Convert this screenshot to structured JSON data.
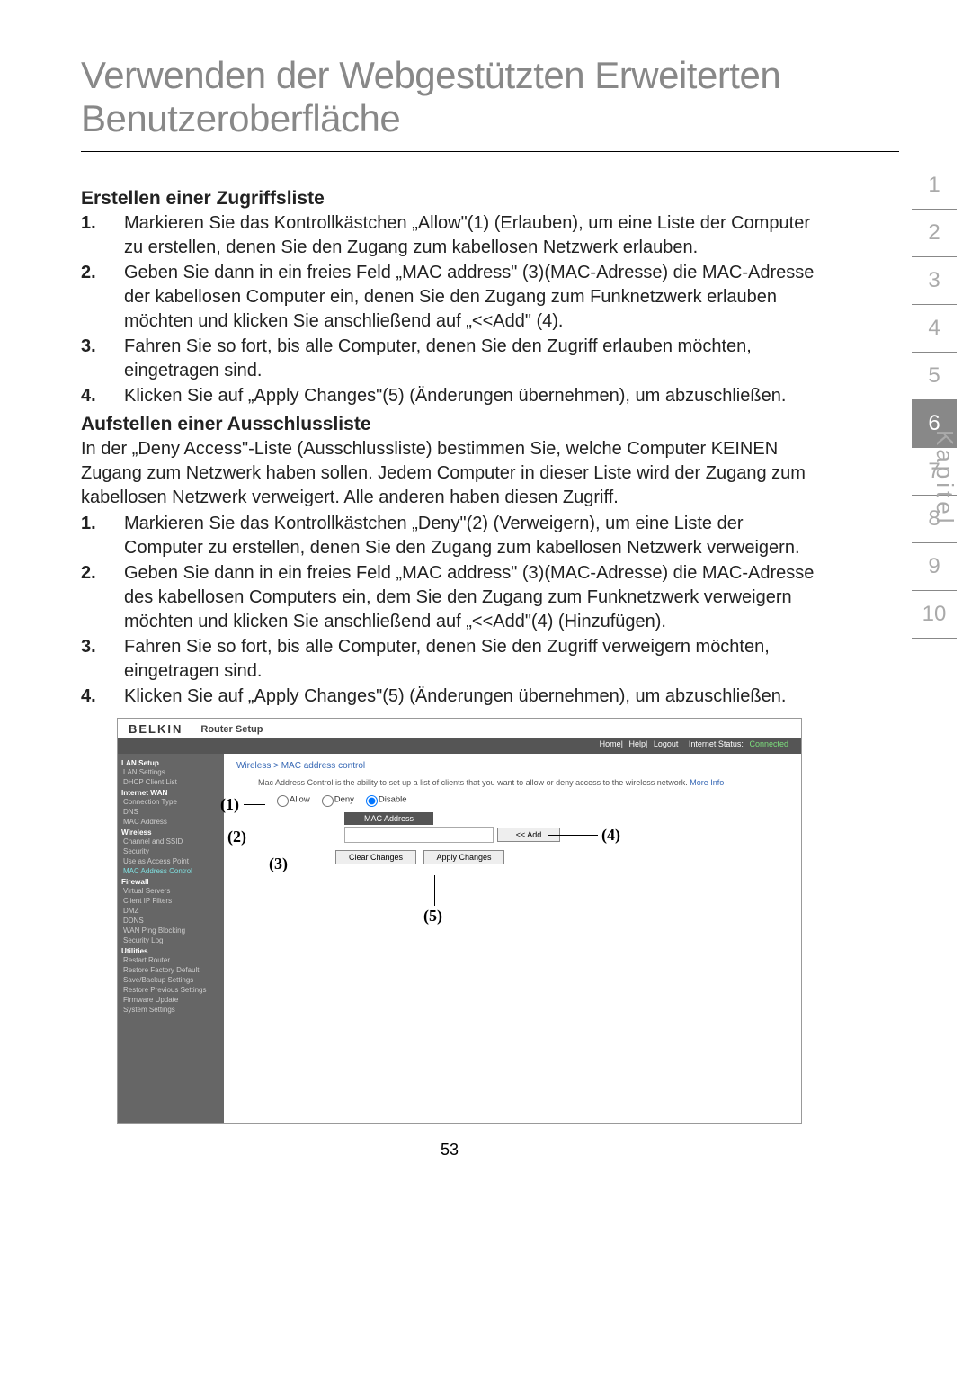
{
  "page": {
    "title": "Verwenden der Webgestützten Erweiterten Benutzeroberfläche",
    "number": "53"
  },
  "section1": {
    "heading": "Erstellen einer Zugriffsliste",
    "items": [
      {
        "n": "1.",
        "text": "Markieren Sie das Kontrollkästchen „Allow\"(1) (Erlauben), um eine Liste der Computer zu erstellen, denen Sie den Zugang zum kabellosen Netzwerk erlauben."
      },
      {
        "n": "2.",
        "text": "Geben Sie dann in ein freies Feld „MAC address\" (3)(MAC-Adresse) die MAC-Adresse der kabellosen Computer ein, denen Sie den Zugang zum Funknetzwerk erlauben möchten und klicken Sie anschließend auf „<<Add\" (4)."
      },
      {
        "n": "3.",
        "text": "Fahren Sie so fort, bis alle Computer, denen Sie den Zugriff erlauben möchten, eingetragen sind."
      },
      {
        "n": "4.",
        "text": "Klicken Sie auf „Apply Changes\"(5) (Änderungen übernehmen), um abzuschließen."
      }
    ]
  },
  "section2": {
    "heading": "Aufstellen einer Ausschlussliste",
    "intro": " In der „Deny Access\"-Liste (Ausschlussliste) bestimmen Sie, welche Computer KEINEN Zugang zum Netzwerk haben sollen. Jedem Computer in dieser Liste wird der Zugang zum kabellosen Netzwerk verweigert. Alle anderen haben diesen Zugriff.",
    "items": [
      {
        "n": "1.",
        "text": "Markieren Sie das Kontrollkästchen „Deny\"(2) (Verweigern), um eine Liste der Computer zu erstellen, denen Sie den Zugang zum kabellosen Netzwerk verweigern."
      },
      {
        "n": "2.",
        "text": "Geben Sie dann in ein freies Feld „MAC address\" (3)(MAC-Adresse) die MAC-Adresse des kabellosen Computers ein, dem Sie den Zugang zum Funknetzwerk verweigern möchten und klicken Sie anschließend auf „<<Add\"(4) (Hinzufügen)."
      },
      {
        "n": "3.",
        "text": "Fahren Sie so fort, bis alle Computer, denen Sie den Zugriff verweigern möchten, eingetragen sind."
      },
      {
        "n": "4.",
        "text": "Klicken Sie auf „Apply Changes\"(5) (Änderungen übernehmen), um abzuschließen."
      }
    ]
  },
  "chapter_nav": {
    "label": "Kapitel",
    "items": [
      "1",
      "2",
      "3",
      "4",
      "5",
      "6",
      "7",
      "8",
      "9",
      "10"
    ],
    "active": "6"
  },
  "screenshot": {
    "logo": "BELKIN",
    "router_setup": "Router Setup",
    "topbar": {
      "home": "Home",
      "help": "Help",
      "logout": "Logout",
      "status_label": "Internet Status:",
      "status_value": "Connected"
    },
    "breadcrumb": "Wireless > MAC address control",
    "desc": "Mac Address Control is the ability to set up a list of clients that you want to allow or deny access to the wireless network.",
    "more_info": "More Info",
    "options": {
      "allow": "Allow",
      "deny": "Deny",
      "disable": "Disable"
    },
    "mac_header": "MAC Address",
    "add_btn": "<< Add",
    "clear_btn": "Clear Changes",
    "apply_btn": "Apply Changes",
    "annotations": {
      "a1": "(1)",
      "a2": "(2)",
      "a3": "(3)",
      "a4": "(4)",
      "a5": "(5)"
    },
    "sidebar": {
      "lan_setup": "LAN Setup",
      "lan_settings": "LAN Settings",
      "dhcp": "DHCP Client List",
      "internet_wan": "Internet WAN",
      "conn_type": "Connection Type",
      "dns": "DNS",
      "mac_addr": "MAC Address",
      "wireless": "Wireless",
      "channel_ssid": "Channel and SSID",
      "security": "Security",
      "use_ap": "Use as Access Point",
      "mac_ctrl": "MAC Address Control",
      "firewall": "Firewall",
      "virtual_servers": "Virtual Servers",
      "client_ip": "Client IP Filters",
      "dmz": "DMZ",
      "ddns": "DDNS",
      "wan_ping": "WAN Ping Blocking",
      "security_log": "Security Log",
      "utilities": "Utilities",
      "restart": "Restart Router",
      "restore_fd": "Restore Factory Default",
      "save_backup": "Save/Backup Settings",
      "restore_prev": "Restore Previous Settings",
      "firmware": "Firmware Update",
      "system": "System Settings"
    }
  }
}
